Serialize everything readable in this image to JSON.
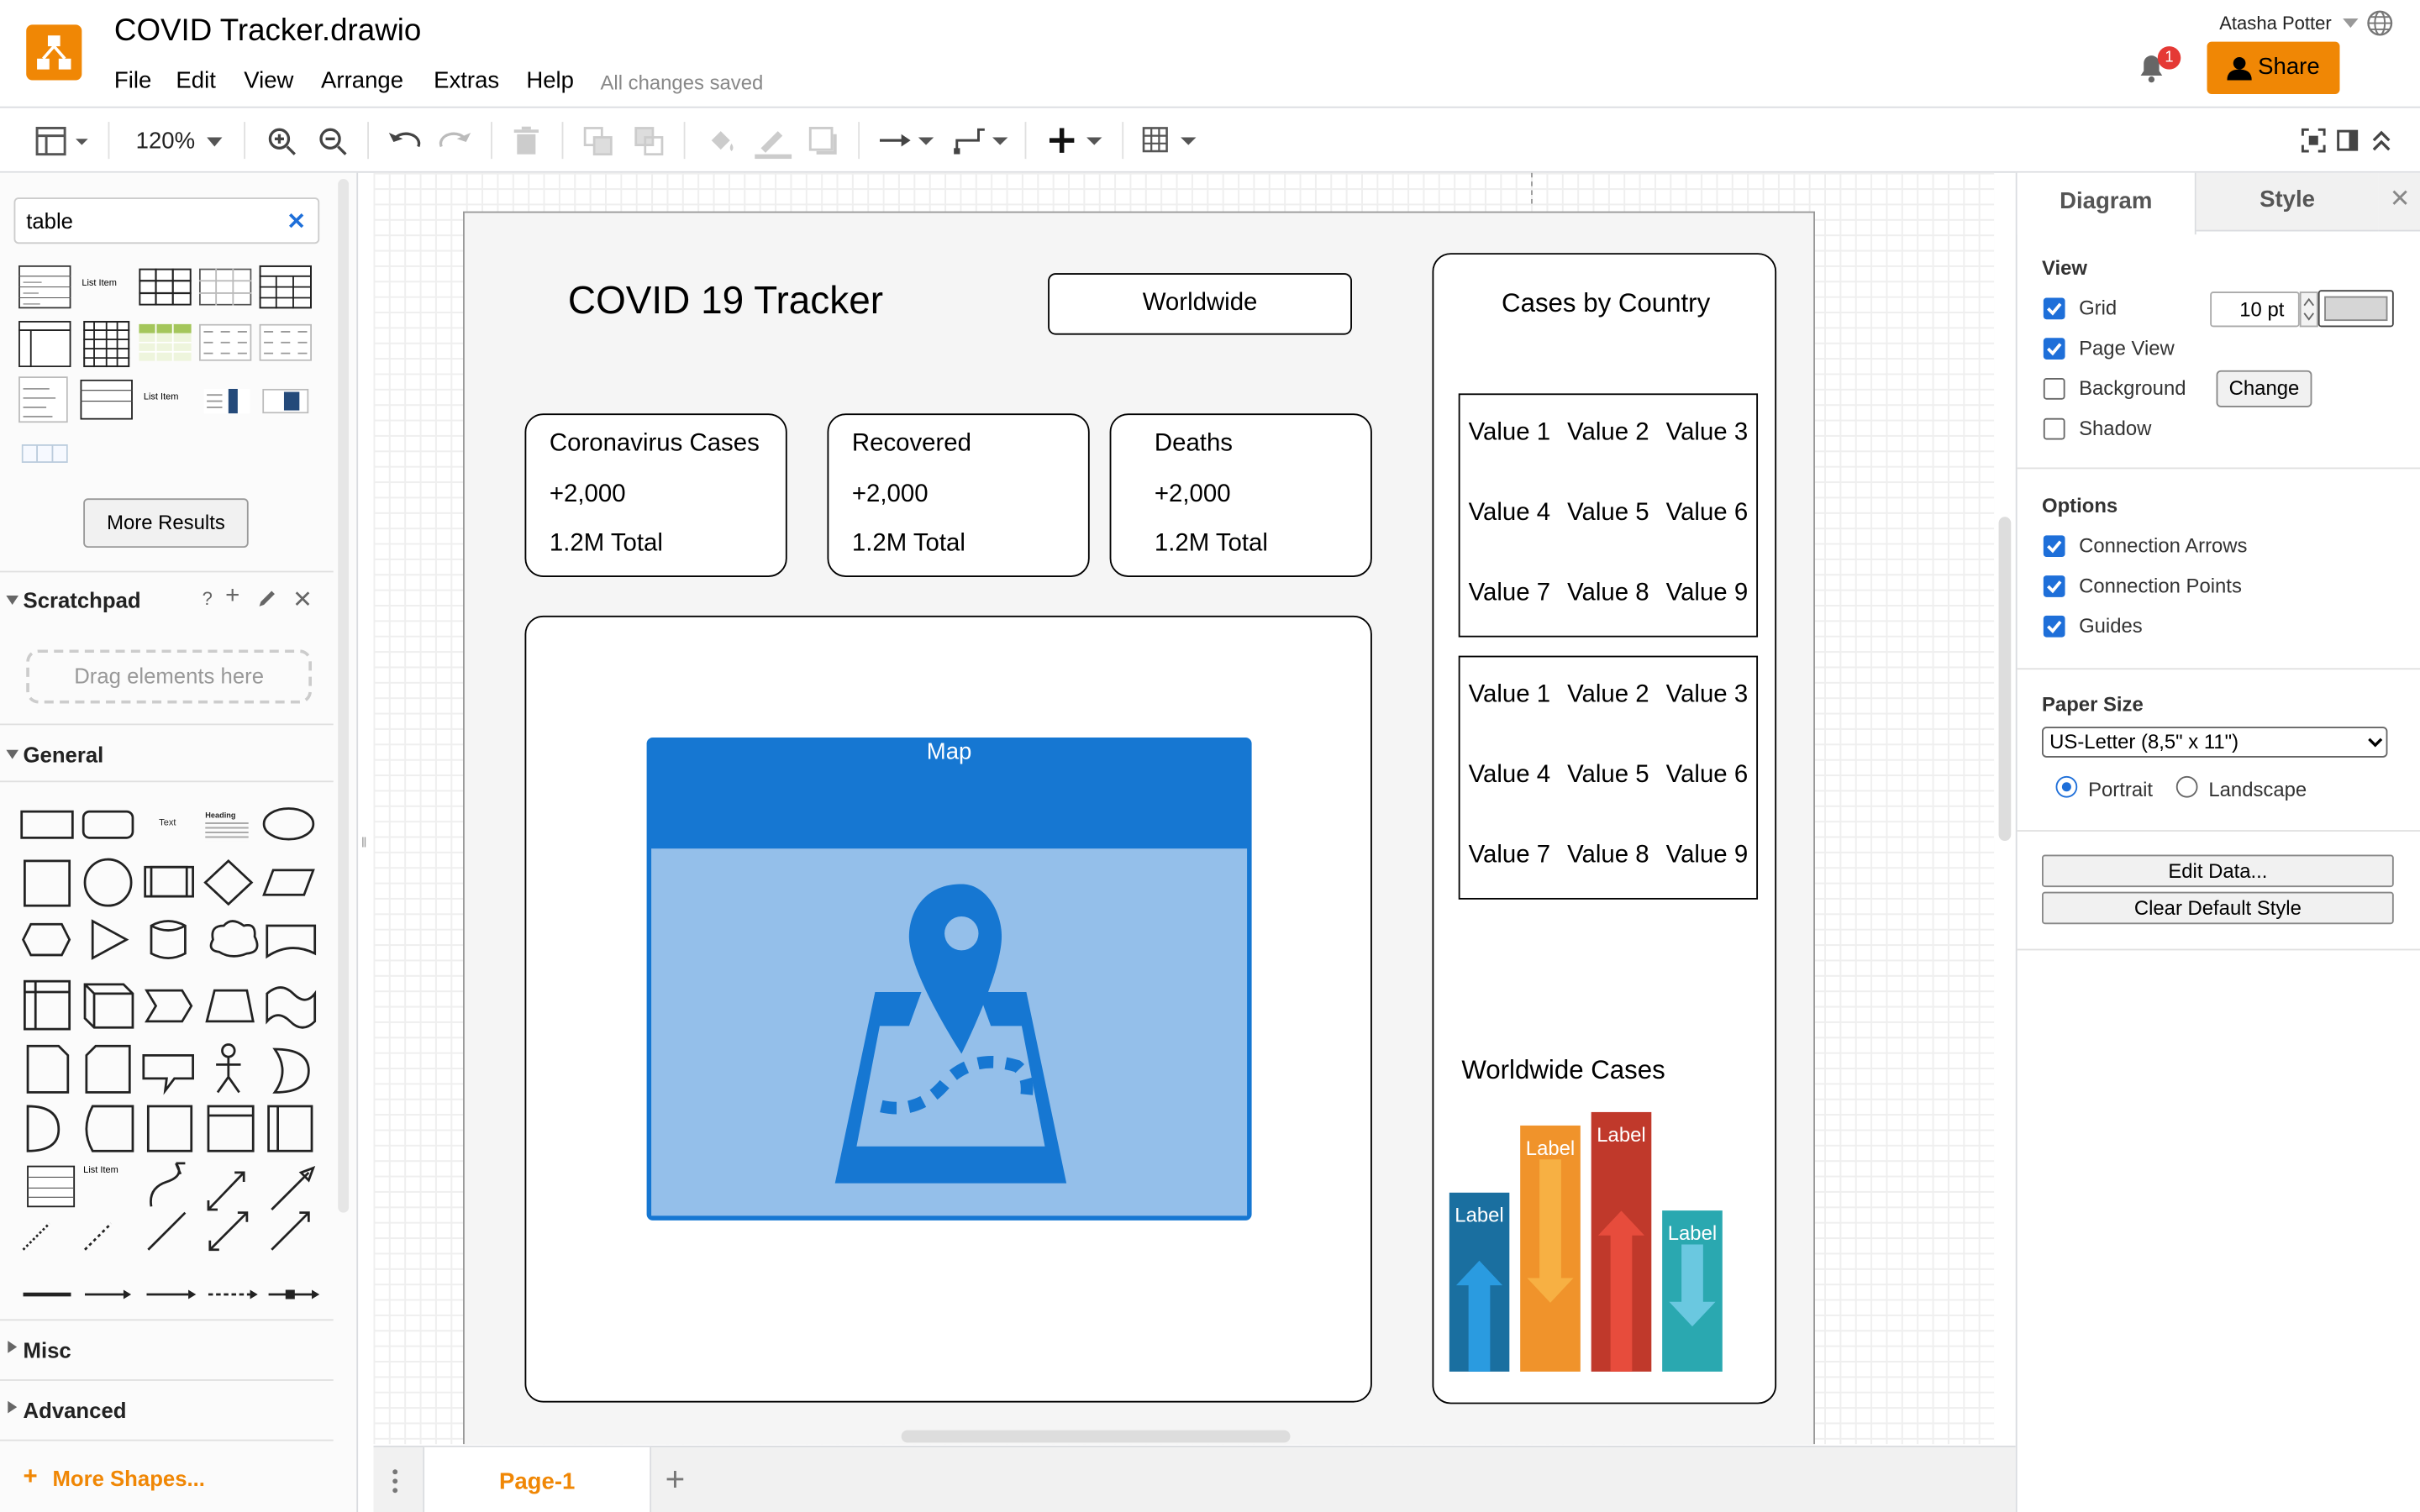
{
  "app": {
    "file_title": "COVID Tracker.drawio",
    "menus": [
      "File",
      "Edit",
      "View",
      "Arrange",
      "Extras",
      "Help"
    ],
    "save_status": "All changes saved",
    "user_name": "Atasha Potter",
    "share_label": "Share",
    "notification_count": "1",
    "accent_color": "#f08705"
  },
  "toolbar": {
    "zoom": "120%"
  },
  "left_panel": {
    "search_value": "table",
    "more_results": "More Results",
    "scratchpad_title": "Scratchpad",
    "drag_hint": "Drag elements here",
    "general_title": "General",
    "misc_title": "Misc",
    "advanced_title": "Advanced",
    "more_shapes": "More Shapes...",
    "list_item_label": "List Item",
    "shape_text": "Text",
    "shape_heading": "Heading"
  },
  "diagram": {
    "title": "COVID 19 Tracker",
    "scope_button": "Worldwide",
    "cards": [
      {
        "title": "Coronavirus Cases",
        "delta": "+2,000",
        "total": "1.2M Total"
      },
      {
        "title": "Recovered",
        "delta": "+2,000",
        "total": "1.2M Total"
      },
      {
        "title": "Deaths",
        "delta": "+2,000",
        "total": "1.2M Total"
      }
    ],
    "map_label": "Map",
    "country_panel_title": "Cases by Country",
    "table_rows": [
      [
        "Value 1",
        "Value 2",
        "Value 3"
      ],
      [
        "Value 4",
        "Value 5",
        "Value 6"
      ],
      [
        "Value 7",
        "Value 8",
        "Value 9"
      ]
    ],
    "worldwide_cases_title": "Worldwide Cases",
    "bar_labels": [
      "Label",
      "Label",
      "Label",
      "Label"
    ]
  },
  "chart_data": {
    "type": "bar",
    "title": "Worldwide Cases",
    "categories": [
      "Label",
      "Label",
      "Label",
      "Label"
    ],
    "values": [
      4,
      5.5,
      5.8,
      3.6
    ],
    "colors": [
      "#1a6fa0",
      "#f0932b",
      "#c0392b",
      "#2aa8b0"
    ],
    "directions": [
      "up",
      "down",
      "up",
      "down"
    ]
  },
  "bottom": {
    "page_tab": "Page-1"
  },
  "right_panel": {
    "tab_diagram": "Diagram",
    "tab_style": "Style",
    "view_title": "View",
    "grid_label": "Grid",
    "grid_size": "10 pt",
    "page_view_label": "Page View",
    "background_label": "Background",
    "change_label": "Change",
    "shadow_label": "Shadow",
    "options_title": "Options",
    "connection_arrows": "Connection Arrows",
    "connection_points": "Connection Points",
    "guides": "Guides",
    "paper_size_title": "Paper Size",
    "paper_size_value": "US-Letter (8,5\" x 11\")",
    "portrait": "Portrait",
    "landscape": "Landscape",
    "edit_data": "Edit Data...",
    "clear_style": "Clear Default Style"
  }
}
